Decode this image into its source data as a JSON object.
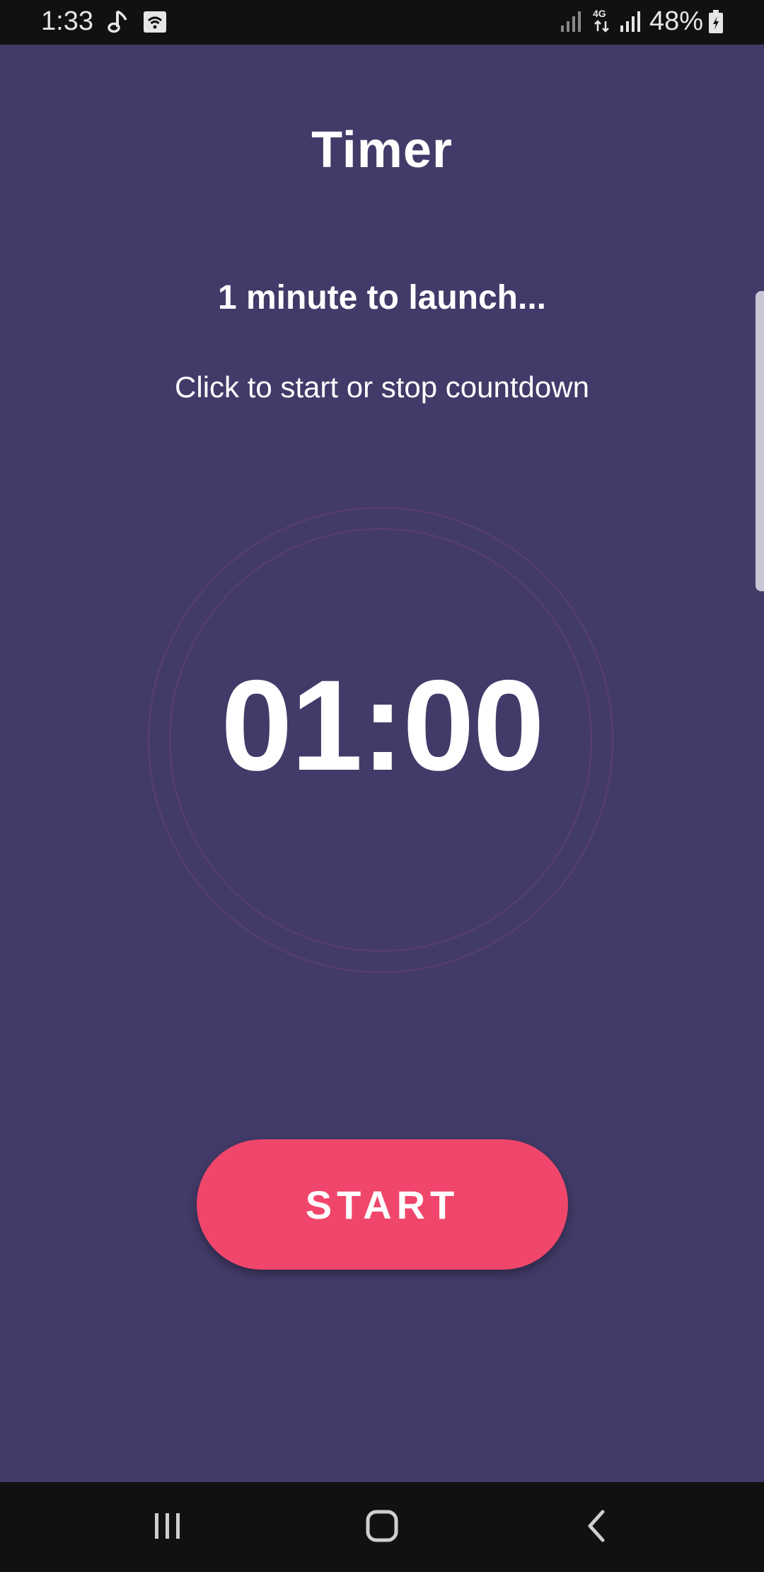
{
  "status_bar": {
    "time": "1:33",
    "battery": "48%",
    "icons": [
      "music-note-icon",
      "wifi-box-icon",
      "signal-icon",
      "4g-data-icon",
      "signal-icon",
      "battery-charging-icon"
    ]
  },
  "app": {
    "title": "Timer",
    "subtitle": "1 minute to launch...",
    "hint": "Click to start or stop countdown",
    "countdown": "01:00",
    "start_label": "START"
  },
  "nav_bar": {
    "icons": [
      "recents-icon",
      "home-icon",
      "back-icon"
    ]
  },
  "colors": {
    "background": "#423b69",
    "accent": "#f0466b",
    "system_bar": "#111111"
  }
}
